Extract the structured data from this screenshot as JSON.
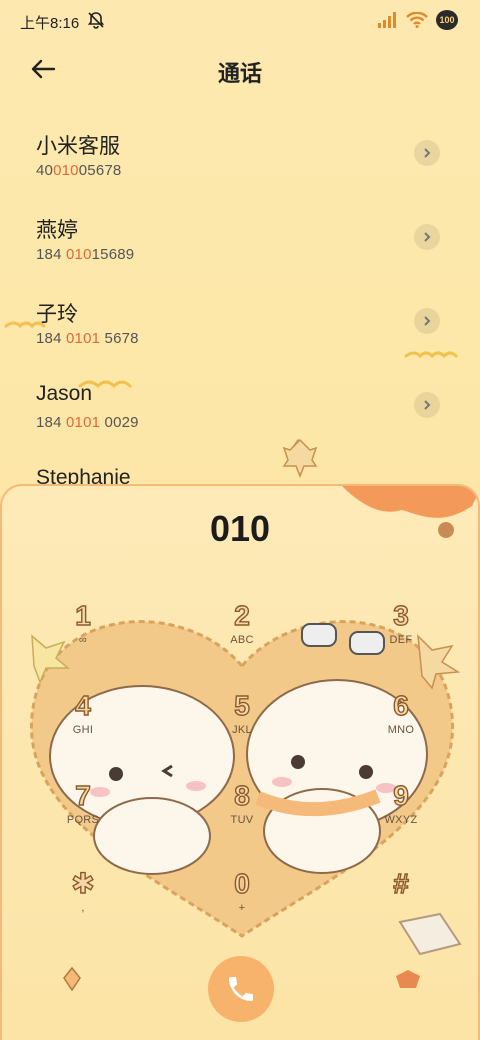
{
  "status": {
    "time": "上午8:16",
    "battery": "100",
    "icons": [
      "mute-bell-icon",
      "signal-icon",
      "wifi-icon",
      "battery-icon"
    ]
  },
  "header": {
    "title": "通话",
    "back_icon": "back-arrow-icon"
  },
  "contacts": [
    {
      "name": "小米客服",
      "num_a": "40",
      "num_hl": "010",
      "num_b": "05678"
    },
    {
      "name": "燕婷",
      "num_a": "184 ",
      "num_hl": "010",
      "num_b": "15689"
    },
    {
      "name": "子玲",
      "num_a": "184 ",
      "num_hl": "0101",
      "num_b": " 5678"
    },
    {
      "name": "Jason",
      "num_a": "184 ",
      "num_hl": "0101",
      "num_b": " 0029"
    },
    {
      "name": "Stephanie",
      "num_a": "",
      "num_hl": "",
      "num_b": ""
    }
  ],
  "dialer": {
    "number": "010",
    "keys": [
      {
        "digit": "1",
        "letters": "∞"
      },
      {
        "digit": "2",
        "letters": "ABC"
      },
      {
        "digit": "3",
        "letters": "DEF"
      },
      {
        "digit": "4",
        "letters": "GHI"
      },
      {
        "digit": "5",
        "letters": "JKL"
      },
      {
        "digit": "6",
        "letters": "MNO"
      },
      {
        "digit": "7",
        "letters": "PQRS"
      },
      {
        "digit": "8",
        "letters": "TUV"
      },
      {
        "digit": "9",
        "letters": "WXYZ"
      },
      {
        "digit": "✱",
        "letters": ","
      },
      {
        "digit": "0",
        "letters": "+"
      },
      {
        "digit": "#",
        "letters": ""
      }
    ],
    "call_icon": "phone-icon"
  },
  "colors": {
    "accent": "#f7b36b",
    "highlight": "#e0693a",
    "background": "#fde9b0"
  }
}
